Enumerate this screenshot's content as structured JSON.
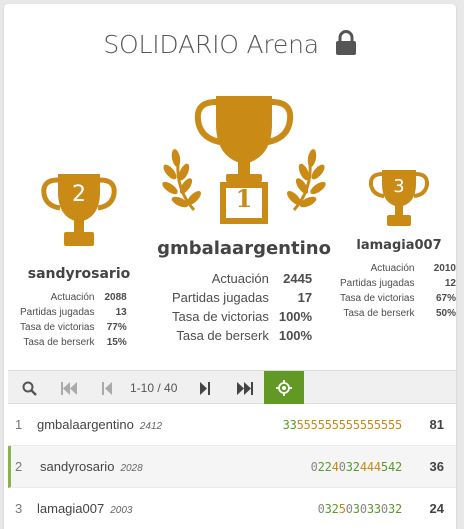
{
  "header": {
    "title": "SOLIDARIO Arena",
    "lock_icon": "lock-icon"
  },
  "colors": {
    "gold": "#c98a16",
    "accent_green": "#629924",
    "streak_green": "#5a9a2a"
  },
  "podium": {
    "first": {
      "rank": "1",
      "name": "gmbalaargentino",
      "stats": [
        {
          "label": "Actuación",
          "value": "2445"
        },
        {
          "label": "Partidas jugadas",
          "value": "17"
        },
        {
          "label": "Tasa de victorias",
          "value": "100%"
        },
        {
          "label": "Tasa de berserk",
          "value": "100%"
        }
      ]
    },
    "second": {
      "rank": "2",
      "name": "sandyrosario",
      "stats": [
        {
          "label": "Actuación",
          "value": "2088"
        },
        {
          "label": "Partidas jugadas",
          "value": "13"
        },
        {
          "label": "Tasa de victorias",
          "value": "77%"
        },
        {
          "label": "Tasa de berserk",
          "value": "15%"
        }
      ]
    },
    "third": {
      "rank": "3",
      "name": "lamagia007",
      "stats": [
        {
          "label": "Actuación",
          "value": "2010"
        },
        {
          "label": "Partidas jugadas",
          "value": "12"
        },
        {
          "label": "Tasa de victorias",
          "value": "67%"
        },
        {
          "label": "Tasa de berserk",
          "value": "50%"
        }
      ]
    }
  },
  "pager": {
    "page_info": "1-10 / 40",
    "icons": [
      "search-icon",
      "first-page-icon",
      "prev-page-icon",
      "next-page-icon",
      "last-page-icon",
      "crosshair-icon"
    ]
  },
  "standings": [
    {
      "rank": "1",
      "name": "gmbalaargentino",
      "rating": "2412",
      "sheet_green": "33",
      "sheet_orange": "555555555555555",
      "sheet_gray": "",
      "score": "81"
    },
    {
      "rank": "2",
      "name": "sandyrosario",
      "rating": "2028",
      "sheet_html": [
        [
          "n",
          "0"
        ],
        [
          "g",
          "22"
        ],
        [
          "o",
          "4"
        ],
        [
          "n",
          "0"
        ],
        [
          "g",
          "32"
        ],
        [
          "o",
          "444"
        ],
        [
          "g",
          "542"
        ]
      ],
      "score": "36"
    },
    {
      "rank": "3",
      "name": "lamagia007",
      "rating": "2003",
      "sheet_html": [
        [
          "n",
          "0"
        ],
        [
          "g",
          "32"
        ],
        [
          "o",
          "5"
        ],
        [
          "n",
          "0"
        ],
        [
          "g",
          "3"
        ],
        [
          "n",
          "0"
        ],
        [
          "g",
          "33"
        ],
        [
          "n",
          "0"
        ],
        [
          "g",
          "32"
        ]
      ],
      "score": "24"
    }
  ]
}
